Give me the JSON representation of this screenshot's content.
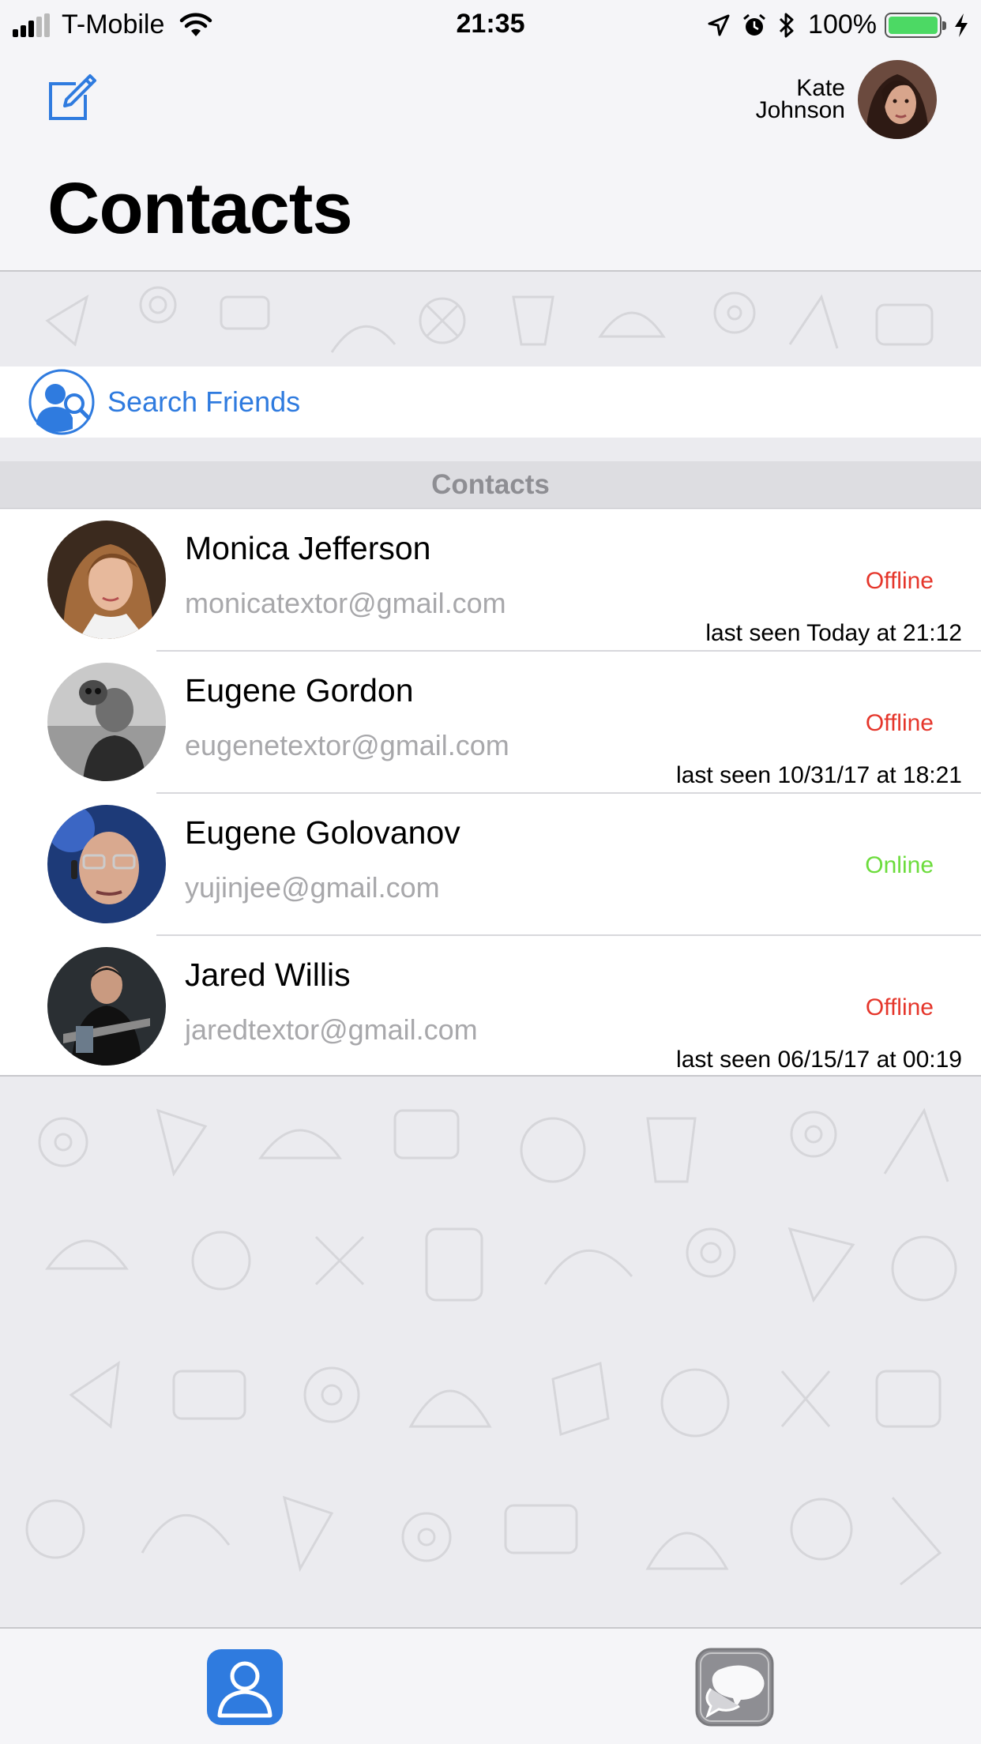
{
  "status_bar": {
    "carrier": "T-Mobile",
    "time": "21:35",
    "battery_percent": "100%",
    "battery_level": 1.0,
    "signal_bars_active": 3,
    "signal_bars_total": 5
  },
  "header": {
    "title": "Contacts",
    "profile": {
      "first_name": "Kate",
      "last_name": "Johnson"
    }
  },
  "search": {
    "label": "Search Friends"
  },
  "section": {
    "title": "Contacts"
  },
  "contacts": [
    {
      "name": "Monica Jefferson",
      "email": "monicatextor@gmail.com",
      "status": "Offline",
      "last_seen": "last seen Today at 21:12"
    },
    {
      "name": "Eugene Gordon",
      "email": "eugenetextor@gmail.com",
      "status": "Offline",
      "last_seen": "last seen 10/31/17 at 18:21"
    },
    {
      "name": "Eugene Golovanov",
      "email": "yujinjee@gmail.com",
      "status": "Online",
      "last_seen": ""
    },
    {
      "name": "Jared Willis",
      "email": "jaredtextor@gmail.com",
      "status": "Offline",
      "last_seen": "last seen 06/15/17 at 00:19"
    }
  ],
  "colors": {
    "accent": "#2f7bdf",
    "offline": "#e5362b",
    "online": "#6cdc3c",
    "email": "#a8a8ab"
  },
  "icons": {
    "compose": "compose-icon",
    "search": "search-friends-icon",
    "tab_contacts": "contacts-tab-icon",
    "tab_chats": "chats-tab-icon"
  }
}
